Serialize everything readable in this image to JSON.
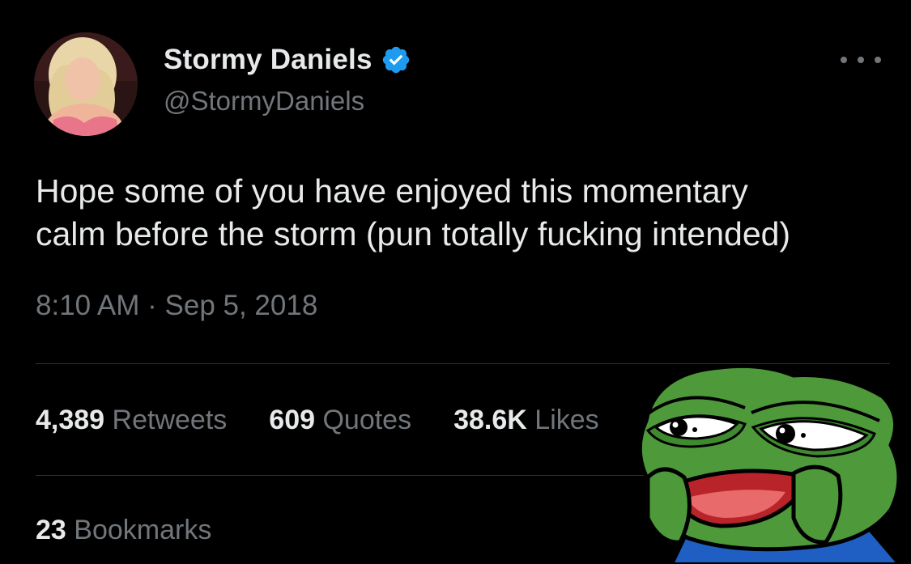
{
  "user": {
    "display_name": "Stormy Daniels",
    "handle": "@StormyDaniels",
    "verified": true
  },
  "tweet": {
    "text_lines": [
      "Hope some of you have enjoyed this momentary",
      "calm before the storm (pun totally fucking intended)"
    ],
    "timestamp": "8:10 AM · Sep 5, 2018"
  },
  "stats": {
    "retweets": {
      "count": "4,389",
      "label": "Retweets"
    },
    "quotes": {
      "count": "609",
      "label": "Quotes"
    },
    "likes": {
      "count": "38.6K",
      "label": "Likes"
    },
    "bookmarks": {
      "count": "23",
      "label": "Bookmarks"
    }
  },
  "icons": {
    "more": "more-horizontal-icon",
    "verified": "verified-badge-icon"
  },
  "colors": {
    "background": "#000000",
    "primary_text": "#e7e9ea",
    "secondary_text": "#71767b",
    "divider": "#2f3336",
    "verified_blue": "#1d9bf0"
  }
}
